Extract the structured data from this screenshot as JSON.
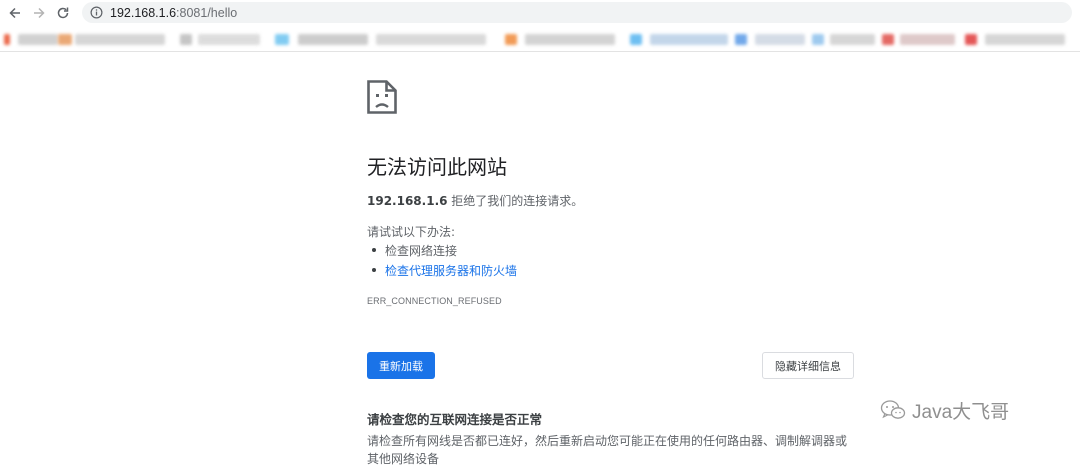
{
  "browser": {
    "url_host": "192.168.1.6",
    "url_rest": ":8081/hello",
    "icons": {
      "back": "back-arrow-icon",
      "forward": "forward-arrow-icon",
      "reload": "reload-icon",
      "site_info": "info-icon"
    }
  },
  "error_page": {
    "icon": "sad-page-icon",
    "title": "无法访问此网站",
    "host": "192.168.1.6",
    "summary_suffix": " 拒绝了我们的连接请求。",
    "try_label": "请试试以下办法:",
    "suggestions": [
      "检查网络连接",
      "检查代理服务器和防火墙"
    ],
    "error_code": "ERR_CONNECTION_REFUSED",
    "reload_button": "重新加载",
    "details_button": "隐藏详细信息",
    "check_title": "请检查您的互联网连接是否正常",
    "check_body": "请检查所有网线是否都已连好，然后重新启动您可能正在使用的任何路由器、调制解调器或",
    "check_body_cont": "其他网络设备"
  },
  "watermark": {
    "icon": "wechat-icon",
    "text": "Java大飞哥"
  },
  "colors": {
    "primary_button": "#1a73e8",
    "link": "#1a73e8",
    "text": "#202124",
    "secondary_text": "#5f6368",
    "omnibox_bg": "#f1f3f4"
  }
}
